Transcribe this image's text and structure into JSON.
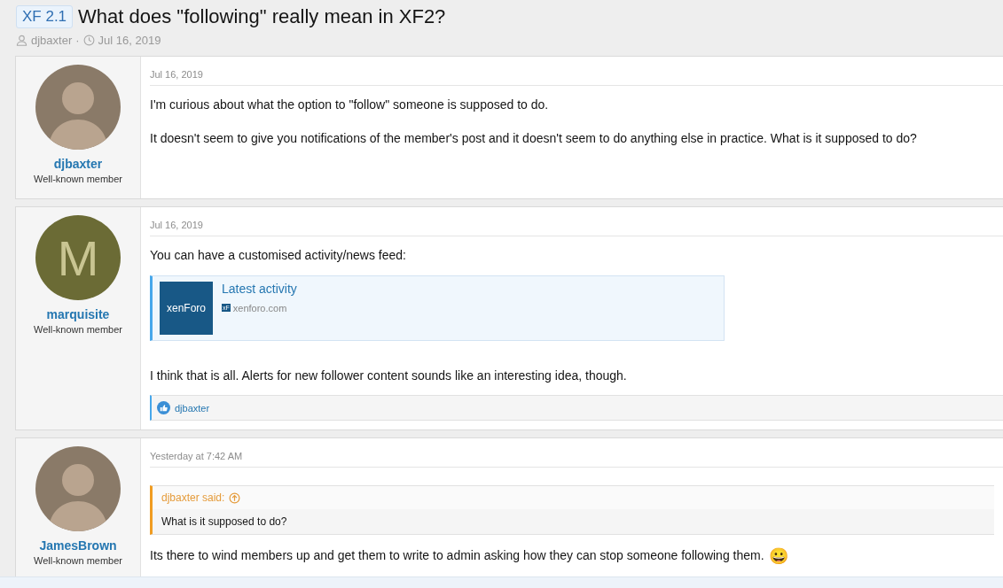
{
  "thread": {
    "prefix": "XF 2.1",
    "title": "What does \"following\" really mean in XF2?",
    "author": "djbaxter",
    "separator": "·",
    "date": "Jul 16, 2019"
  },
  "posts": [
    {
      "user": {
        "name": "djbaxter",
        "title": "Well-known member",
        "avatar": {
          "kind": "photo"
        }
      },
      "date": "Jul 16, 2019",
      "blocks": [
        {
          "kind": "paragraph",
          "text": "I'm curious about what the option to \"follow\" someone is supposed to do."
        },
        {
          "kind": "paragraph",
          "text": "It doesn't seem to give you notifications of the member's post and it doesn't seem to do anything else in practice. What is it supposed to do?"
        }
      ]
    },
    {
      "user": {
        "name": "marquisite",
        "title": "Well-known member",
        "avatar": {
          "kind": "letter",
          "letter": "M",
          "color": "#6b6b35"
        }
      },
      "date": "Jul 16, 2019",
      "blocks": [
        {
          "kind": "paragraph",
          "text": "You can have a customised activity/news feed:"
        },
        {
          "kind": "link-preview",
          "logo": "xenForo",
          "title": "Latest activity",
          "site_icon": "xF",
          "domain": "xenforo.com"
        },
        {
          "kind": "paragraph",
          "text": "I think that is all. Alerts for new follower content sounds like an interesting idea, though."
        }
      ],
      "reactions": {
        "users": "djbaxter"
      }
    },
    {
      "user": {
        "name": "JamesBrown",
        "title": "Well-known member",
        "avatar": {
          "kind": "photo"
        }
      },
      "date": "Yesterday at 7:42 AM",
      "blocks": [
        {
          "kind": "quote",
          "author": "djbaxter said:",
          "text": "What is it supposed to do?"
        },
        {
          "kind": "paragraph",
          "text": "Its there to wind members up and get them to write to admin asking how they can stop someone following them.",
          "emoji": "😀"
        }
      ]
    }
  ]
}
